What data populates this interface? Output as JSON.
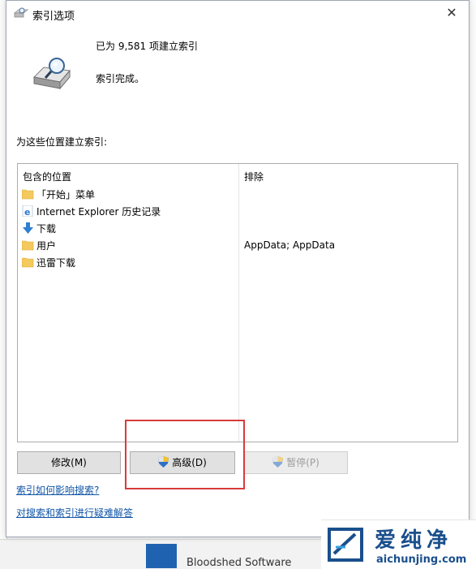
{
  "window": {
    "title": "索引选项",
    "close_glyph": "✕"
  },
  "summary": {
    "count_text": "已为 9,581 项建立索引",
    "status_text": "索引完成。"
  },
  "locations_label": "为这些位置建立索引:",
  "table": {
    "headers": {
      "included": "包含的位置",
      "excluded": "排除"
    },
    "rows": [
      {
        "icon": "folder-icon",
        "name": "「开始」菜单",
        "exclude": ""
      },
      {
        "icon": "internet-explorer-icon",
        "name": "Internet Explorer 历史记录",
        "exclude": ""
      },
      {
        "icon": "download-arrow-icon",
        "name": "下载",
        "exclude": ""
      },
      {
        "icon": "folder-icon",
        "name": "用户",
        "exclude": "AppData; AppData"
      },
      {
        "icon": "folder-icon",
        "name": "迅雷下载",
        "exclude": ""
      }
    ]
  },
  "buttons": {
    "modify": "修改(M)",
    "advanced": "高级(D)",
    "pause": "暂停(P)"
  },
  "links": {
    "how": "索引如何影响搜索?",
    "troubleshoot": "对搜索和索引进行疑难解答"
  },
  "background": {
    "bottom_text": "Bloodshed Software"
  },
  "watermark": {
    "cn": "爱纯净",
    "en": "aichunjing.com"
  },
  "colors": {
    "accent_link": "#1256a8",
    "highlight": "#d83b3b",
    "watermark": "#1a4f8c"
  }
}
